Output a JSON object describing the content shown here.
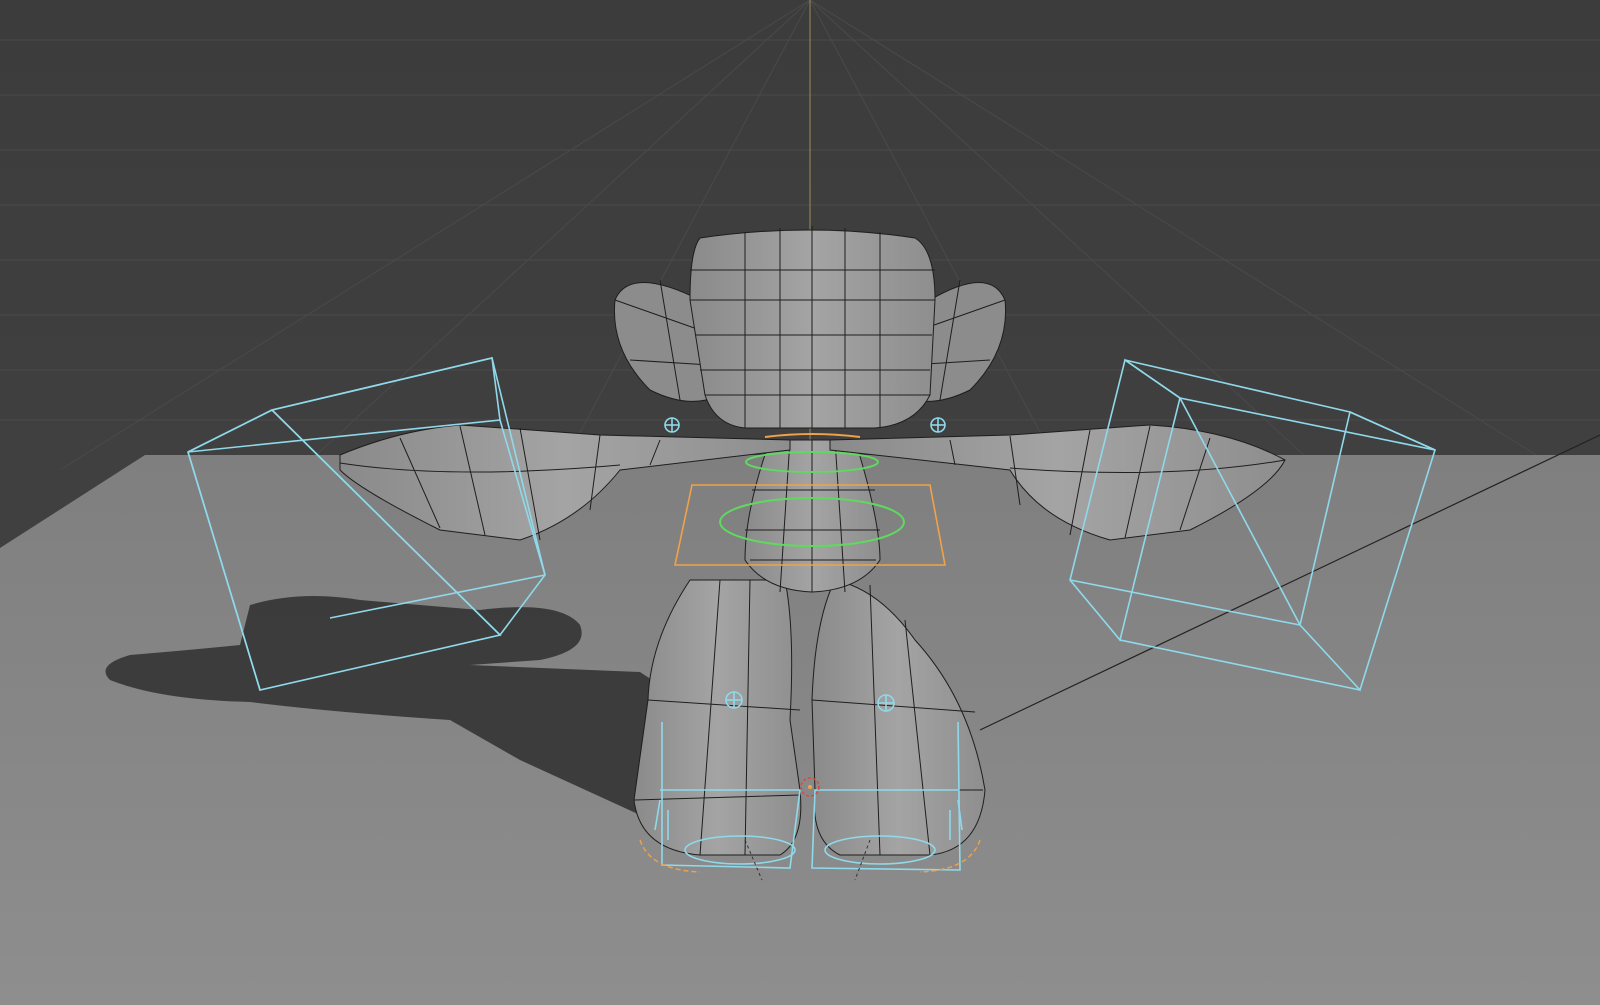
{
  "viewport": {
    "shading": "solid-wireframe",
    "colors": {
      "background": "#3c3c3c",
      "floor": "#8a8a8a",
      "mesh": "#9a9a9a",
      "wire": "#1e1e1e",
      "control_blue": "#8fd9ea",
      "control_green": "#5fd95f",
      "control_orange": "#f0a24a",
      "shadow": "#2c2c2c",
      "axis_line": "#9a8a5a"
    }
  },
  "scene": {
    "character": "rigged-character",
    "controls": [
      "left-hand-ik-box",
      "right-hand-ik-box",
      "hip-root-control",
      "chest-ring",
      "spine-ring",
      "left-foot-ik",
      "right-foot-ik",
      "left-knee-pole",
      "right-knee-pole",
      "left-shoulder-control",
      "right-shoulder-control"
    ]
  }
}
